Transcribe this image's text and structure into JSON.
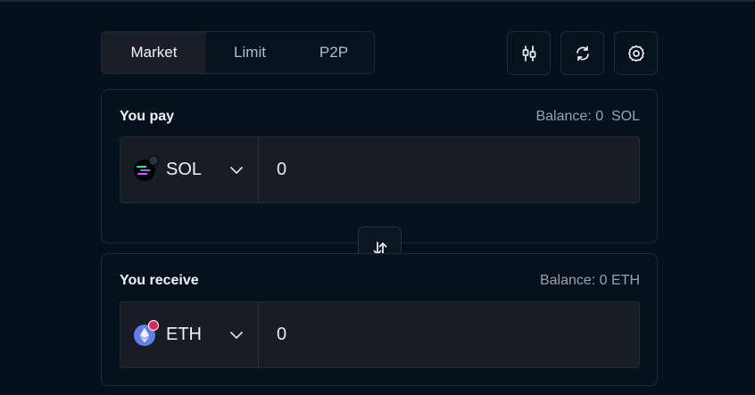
{
  "tabs": [
    {
      "label": "Market",
      "active": true
    },
    {
      "label": "Limit",
      "active": false
    },
    {
      "label": "P2P",
      "active": false
    }
  ],
  "toolbar": {
    "icons": [
      "chart-candles-icon",
      "refresh-icon",
      "settings-gear-icon"
    ]
  },
  "pay": {
    "title": "You pay",
    "balance": "Balance: 0  SOL",
    "token": "SOL",
    "token_icon": "solana-icon",
    "amount": "0"
  },
  "receive": {
    "title": "You receive",
    "balance": "Balance: 0 ETH",
    "token": "ETH",
    "token_icon": "ethereum-icon",
    "amount": "0"
  },
  "swap_icon": "swap-vertical-arrows-icon",
  "colors": {
    "background": "#05111a",
    "card": "#06121b",
    "field": "#181d25",
    "border": "#1f2a35",
    "active_tab": "#1a1f27",
    "eth": "#627eea",
    "badge_red": "#e0245e"
  }
}
